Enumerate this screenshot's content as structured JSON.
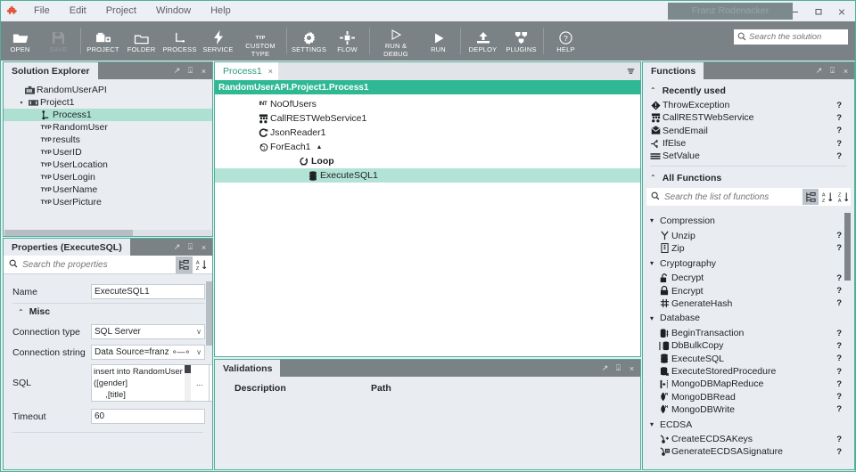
{
  "window": {
    "title": "Franz Rodenacker",
    "logo_icon": "puzzle-piece-icon",
    "minimize": "–",
    "maximize": "☐",
    "close": "×"
  },
  "menubar": {
    "items": [
      {
        "label": "File"
      },
      {
        "label": "Edit"
      },
      {
        "label": "Project"
      },
      {
        "label": "Window"
      },
      {
        "label": "Help"
      }
    ]
  },
  "toolbar": {
    "buttons": [
      {
        "label": "OPEN",
        "icon": "folder-open-icon",
        "disabled": false
      },
      {
        "label": "SAVE",
        "icon": "save-disk-icon",
        "disabled": true
      },
      {
        "label": "PROJECT",
        "icon": "project-add-icon",
        "disabled": false
      },
      {
        "label": "FOLDER",
        "icon": "folder-icon",
        "disabled": false
      },
      {
        "label": "PROCESS",
        "icon": "process-icon",
        "disabled": false
      },
      {
        "label": "SERVICE",
        "icon": "lightning-icon",
        "disabled": false
      },
      {
        "label": "CUSTOM\nTYPE",
        "icon": "custom-type-icon",
        "disabled": false
      },
      {
        "label": "SETTINGS",
        "icon": "gear-icon",
        "disabled": false
      },
      {
        "label": "FLOW",
        "icon": "flow-icon",
        "disabled": false
      },
      {
        "label": "RUN &\nDEBUG",
        "icon": "play-outline-icon",
        "disabled": false
      },
      {
        "label": "RUN",
        "icon": "play-icon",
        "disabled": false
      },
      {
        "label": "DEPLOY",
        "icon": "deploy-upload-icon",
        "disabled": false
      },
      {
        "label": "PLUGINS",
        "icon": "plugins-icon",
        "disabled": false
      },
      {
        "label": "HELP",
        "icon": "help-circle-icon",
        "disabled": false
      }
    ],
    "custom_type_badge": "TYP",
    "search": {
      "placeholder": "Search the solution",
      "value": "",
      "icon": "search-icon"
    }
  },
  "panel_tools": {
    "float": "↗",
    "pin": "⍗",
    "close": "×"
  },
  "solution_explorer": {
    "title": "Solution Explorer",
    "tree": [
      {
        "label": "RandomUserAPI",
        "icon": "solution-icon",
        "indent": 0,
        "twisty": "",
        "selected": false,
        "type_badge": ""
      },
      {
        "label": "Project1",
        "icon": "project-icon",
        "indent": 1,
        "twisty": "▾",
        "selected": false,
        "type_badge": ""
      },
      {
        "label": "Process1",
        "icon": "process-node-icon",
        "indent": 2,
        "twisty": "",
        "selected": true,
        "type_badge": ""
      },
      {
        "label": "RandomUser",
        "icon": "type-icon",
        "indent": 2,
        "twisty": "",
        "selected": false,
        "type_badge": "TYP"
      },
      {
        "label": "results",
        "icon": "type-icon",
        "indent": 2,
        "twisty": "",
        "selected": false,
        "type_badge": "TYP"
      },
      {
        "label": "UserID",
        "icon": "type-icon",
        "indent": 2,
        "twisty": "",
        "selected": false,
        "type_badge": "TYP"
      },
      {
        "label": "UserLocation",
        "icon": "type-icon",
        "indent": 2,
        "twisty": "",
        "selected": false,
        "type_badge": "TYP"
      },
      {
        "label": "UserLogin",
        "icon": "type-icon",
        "indent": 2,
        "twisty": "",
        "selected": false,
        "type_badge": "TYP"
      },
      {
        "label": "UserName",
        "icon": "type-icon",
        "indent": 2,
        "twisty": "",
        "selected": false,
        "type_badge": "TYP"
      },
      {
        "label": "UserPicture",
        "icon": "type-icon",
        "indent": 2,
        "twisty": "",
        "selected": false,
        "type_badge": "TYP"
      }
    ]
  },
  "properties": {
    "title": "Properties (ExecuteSQL)",
    "search": {
      "placeholder": "Search the properties",
      "value": "",
      "icon": "search-icon"
    },
    "view_buttons": [
      {
        "name": "categorized-view-button",
        "icon": "categorized-icon",
        "active": true
      },
      {
        "name": "alphabetical-sort-button",
        "icon": "sort-az-icon",
        "active": false
      }
    ],
    "rows": [
      {
        "label": "Name",
        "value": "ExecuteSQL1",
        "kind": "text"
      }
    ],
    "group": {
      "label": "Misc",
      "chevron": "⌃"
    },
    "misc_rows": [
      {
        "label": "Connection type",
        "value": "SQL Server",
        "kind": "dropdown"
      },
      {
        "label": "Connection string",
        "value": "Data Source=franzpc\\sqls",
        "kind": "dropdown-link"
      },
      {
        "label": "SQL",
        "value": "insert into RandomUser\n([gender]\n     ,[title]",
        "kind": "multiline"
      },
      {
        "label": "Timeout",
        "value": "60",
        "kind": "text"
      }
    ],
    "ellipsis_button": "...",
    "caret": "∨"
  },
  "editor": {
    "tab": {
      "label": "Process1",
      "close": "×"
    },
    "menu_icon": "overflow-menu-icon",
    "breadcrumb": "RandomUserAPI.Project1.Process1",
    "nodes": [
      {
        "label": "NoOfUsers",
        "icon": "int-type-icon",
        "badge": "INT",
        "indent": 0,
        "selected": false,
        "bold": false,
        "collapse": ""
      },
      {
        "label": "CallRESTWebService1",
        "icon": "rest-service-icon",
        "badge": "",
        "indent": 0,
        "selected": false,
        "bold": false,
        "collapse": ""
      },
      {
        "label": "JsonReader1",
        "icon": "json-reader-icon",
        "badge": "",
        "indent": 0,
        "selected": false,
        "bold": false,
        "collapse": ""
      },
      {
        "label": "ForEach1",
        "icon": "foreach-icon",
        "badge": "",
        "indent": 0,
        "selected": false,
        "bold": false,
        "collapse": "▲"
      },
      {
        "label": "Loop",
        "icon": "loop-icon",
        "badge": "",
        "indent": 1,
        "selected": false,
        "bold": true,
        "collapse": ""
      },
      {
        "label": "ExecuteSQL1",
        "icon": "database-icon",
        "badge": "",
        "indent": 2,
        "selected": true,
        "bold": false,
        "collapse": ""
      }
    ]
  },
  "validations": {
    "title": "Validations",
    "columns": [
      "Description",
      "Path"
    ],
    "rows": []
  },
  "functions": {
    "title": "Functions",
    "recently_used": {
      "label": "Recently used",
      "chevron": "⌃",
      "items": [
        {
          "label": "ThrowException",
          "icon": "exception-icon",
          "help": "?"
        },
        {
          "label": "CallRESTWebService",
          "icon": "rest-service-icon",
          "help": "?"
        },
        {
          "label": "SendEmail",
          "icon": "email-icon",
          "help": "?"
        },
        {
          "label": "IfElse",
          "icon": "branch-icon",
          "help": "?"
        },
        {
          "label": "SetValue",
          "icon": "setvalue-icon",
          "help": "?"
        }
      ]
    },
    "all_functions": {
      "label": "All Functions",
      "chevron": "⌃",
      "search": {
        "placeholder": "Search the list of functions",
        "value": "",
        "icon": "search-icon"
      },
      "view_buttons": [
        {
          "name": "tree-view-button",
          "icon": "categorized-icon",
          "active": true
        },
        {
          "name": "sort-ascending-button",
          "icon": "sort-az-icon",
          "active": false
        },
        {
          "name": "sort-descending-button",
          "icon": "sort-za-icon",
          "active": false
        }
      ],
      "groups": [
        {
          "label": "Compression",
          "chevron": "▾",
          "items": [
            {
              "label": "Unzip",
              "icon": "unzip-icon",
              "help": "?"
            },
            {
              "label": "Zip",
              "icon": "zip-icon",
              "help": "?"
            }
          ]
        },
        {
          "label": "Cryptography",
          "chevron": "▾",
          "items": [
            {
              "label": "Decrypt",
              "icon": "unlock-icon",
              "help": "?"
            },
            {
              "label": "Encrypt",
              "icon": "lock-icon",
              "help": "?"
            },
            {
              "label": "GenerateHash",
              "icon": "hash-icon",
              "help": "?"
            }
          ]
        },
        {
          "label": "Database",
          "chevron": "▾",
          "items": [
            {
              "label": "BeginTransaction",
              "icon": "transaction-icon",
              "help": "?"
            },
            {
              "label": "DbBulkCopy",
              "icon": "bulkcopy-icon",
              "help": "?"
            },
            {
              "label": "ExecuteSQL",
              "icon": "database-icon",
              "help": "?"
            },
            {
              "label": "ExecuteStoredProcedure",
              "icon": "storedproc-icon",
              "help": "?"
            },
            {
              "label": "MongoDBMapReduce",
              "icon": "mapreduce-icon",
              "help": "?"
            },
            {
              "label": "MongoDBRead",
              "icon": "mongodb-read-icon",
              "help": "?"
            },
            {
              "label": "MongoDBWrite",
              "icon": "mongodb-write-icon",
              "help": "?"
            }
          ]
        },
        {
          "label": "ECDSA",
          "chevron": "▾",
          "items": [
            {
              "label": "CreateECDSAKeys",
              "icon": "key-add-icon",
              "help": "?"
            },
            {
              "label": "GenerateECDSASignature",
              "icon": "signature-icon",
              "help": "?"
            }
          ]
        }
      ]
    }
  },
  "colors": {
    "accent_teal": "#2fb894",
    "selection_teal": "#b2e3d5",
    "tree_selection": "#aee0d2",
    "toolbar_gray": "#7b8285",
    "panel_bg": "#e9edf2",
    "logo_orange": "#e2553d"
  }
}
